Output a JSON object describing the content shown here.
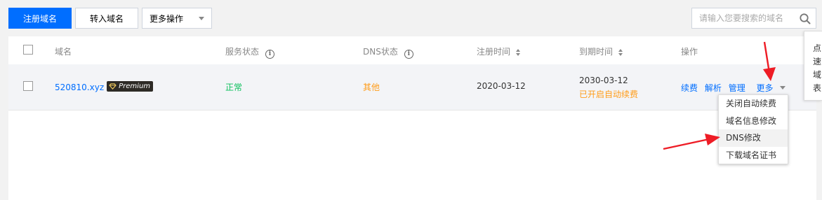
{
  "toolbar": {
    "register_label": "注册域名",
    "transfer_label": "转入域名",
    "more_ops_label": "更多操作"
  },
  "search": {
    "placeholder": "请输入您要搜索的域名"
  },
  "table": {
    "headers": {
      "domain": "域名",
      "service_status": "服务状态",
      "dns_status": "DNS状态",
      "register_time": "注册时间",
      "expire_time": "到期时间",
      "actions": "操作"
    },
    "rows": [
      {
        "domain": "520810.xyz",
        "badge": "Premium",
        "service_status": "正常",
        "dns_status": "其他",
        "register_time": "2020-03-12",
        "expire_time": "2030-03-12",
        "auto_renew": "已开启自动续费",
        "actions": [
          "续费",
          "解析",
          "管理",
          "更多"
        ]
      }
    ]
  },
  "dropdown": {
    "items": [
      "关闭自动续费",
      "域名信息修改",
      "DNS修改",
      "下载域名证书"
    ]
  },
  "side_tip": [
    "点",
    "速",
    "域",
    "表"
  ],
  "colors": {
    "primary": "#006eff",
    "success": "#0abf5b",
    "warning": "#ff9c19",
    "arrow": "#ee1c25"
  },
  "icons": [
    "search-icon",
    "info-icon",
    "sort-icon",
    "caret-down-icon",
    "premium-diamond-icon",
    "arrow-annotation"
  ]
}
